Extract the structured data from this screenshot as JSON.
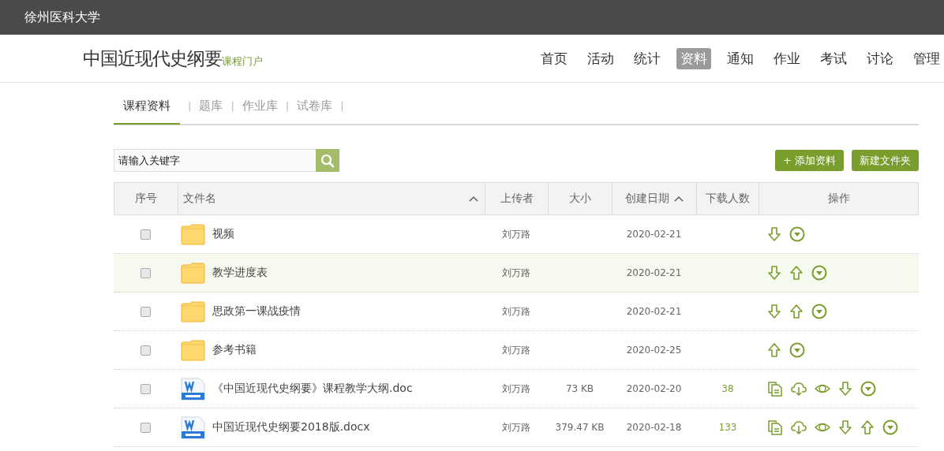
{
  "topbar": {
    "school": "徐州医科大学"
  },
  "header": {
    "course_title": "中国近现代史纲要",
    "portal_label": "课程门户",
    "nav": [
      {
        "label": "首页",
        "selected": false
      },
      {
        "label": "活动",
        "selected": false
      },
      {
        "label": "统计",
        "selected": false
      },
      {
        "label": "资料",
        "selected": true
      },
      {
        "label": "通知",
        "selected": false
      },
      {
        "label": "作业",
        "selected": false
      },
      {
        "label": "考试",
        "selected": false
      },
      {
        "label": "讨论",
        "selected": false
      },
      {
        "label": "管理",
        "selected": false
      }
    ]
  },
  "subtabs": [
    {
      "label": "课程资料",
      "selected": true,
      "separator": "|"
    },
    {
      "label": "题库",
      "selected": false,
      "separator": "|"
    },
    {
      "label": "作业库",
      "selected": false,
      "separator": "|"
    },
    {
      "label": "试卷库",
      "selected": false,
      "separator": "|"
    }
  ],
  "search": {
    "placeholder": "请输入关键字"
  },
  "buttons": [
    "+ 添加资料",
    "新建文件夹"
  ],
  "table": {
    "columns": [
      {
        "label": "序号",
        "sortable": false
      },
      {
        "label": "文件名",
        "sortable": true
      },
      {
        "label": "上传者",
        "sortable": false
      },
      {
        "label": "大小",
        "sortable": false
      },
      {
        "label": "创建日期",
        "sortable": true
      },
      {
        "label": "下载人数",
        "sortable": false
      },
      {
        "label": "操作",
        "sortable": false
      }
    ],
    "rows": [
      {
        "checked": false,
        "highlighted": false,
        "kind": "folder",
        "name": "视频",
        "uploader": "刘万路",
        "date": "2020-02-21",
        "actions": [
          {
            "kind": "down"
          },
          {
            "kind": "menu"
          }
        ]
      },
      {
        "checked": false,
        "highlighted": true,
        "kind": "folder",
        "name": "教学进度表",
        "uploader": "刘万路",
        "date": "2020-02-21",
        "actions": [
          {
            "kind": "down"
          },
          {
            "kind": "up"
          },
          {
            "kind": "menu"
          }
        ]
      },
      {
        "checked": false,
        "highlighted": false,
        "kind": "folder",
        "name": "思政第一课战疫情",
        "uploader": "刘万路",
        "date": "2020-02-21",
        "actions": [
          {
            "kind": "down"
          },
          {
            "kind": "up"
          },
          {
            "kind": "menu"
          }
        ]
      },
      {
        "checked": false,
        "highlighted": false,
        "kind": "folder",
        "name": "参考书籍",
        "uploader": "刘万路",
        "date": "2020-02-25",
        "actions": [
          {
            "kind": "up"
          },
          {
            "kind": "menu"
          }
        ]
      },
      {
        "checked": false,
        "highlighted": false,
        "kind": "word",
        "name": "《中国近现代史纲要》课程教学大纲.doc",
        "uploader": "刘万路",
        "size": "73 KB",
        "date": "2020-02-20",
        "downloads": "38",
        "actions": [
          {
            "kind": "copy"
          },
          {
            "kind": "cloud"
          },
          {
            "kind": "eye"
          },
          {
            "kind": "down"
          },
          {
            "kind": "menu"
          }
        ]
      },
      {
        "checked": false,
        "highlighted": false,
        "kind": "word",
        "name": "中国近现代史纲要2018版.docx",
        "uploader": "刘万路",
        "size": "379.47 KB",
        "date": "2020-02-18",
        "downloads": "133",
        "actions": [
          {
            "kind": "copy"
          },
          {
            "kind": "cloud"
          },
          {
            "kind": "eye"
          },
          {
            "kind": "down"
          },
          {
            "kind": "up"
          },
          {
            "kind": "menu"
          }
        ]
      }
    ]
  }
}
